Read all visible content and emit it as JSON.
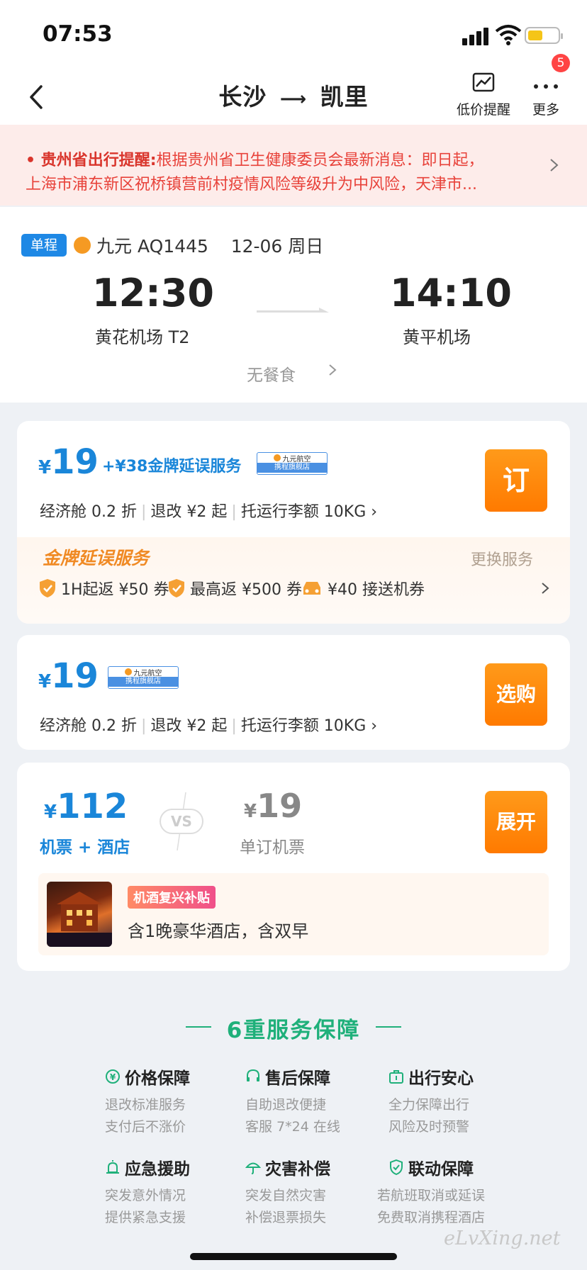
{
  "status_bar": {
    "time": "07:53",
    "battery_color": "#f5c518"
  },
  "nav": {
    "title": "长沙 ⟶ 凯里",
    "title_from": "长沙",
    "title_to": "凯里",
    "low_price_label": "低价提醒",
    "more_label": "更多",
    "more_badge": "5"
  },
  "notice": {
    "bold": "贵州省出行提醒:",
    "line1": "根据贵州省卫生健康委员会最新消息：即日起，",
    "line2": "上海市浦东新区祝桥镇营前村疫情风险等级升为中风险，天津市..."
  },
  "flight": {
    "trip_type": "单程",
    "info": "九元 AQ1445    12-06 周日",
    "dep_time": "12:30",
    "arr_time": "14:10",
    "dep_airport": "黄花机场 T2",
    "arr_airport": "黄平机场",
    "meal": "无餐食"
  },
  "cards": [
    {
      "price_symbol": "¥",
      "price": "19",
      "addon": "+¥38金牌延误服务",
      "tag_top": "九元航空",
      "tag_bottom": "携程旗舰店",
      "button": "订",
      "cabin": "经济舱 0.2 折",
      "refund": "退改 ¥2 起",
      "baggage": "托运行李额 10KG",
      "service_title": "金牌延误服务",
      "change_service": "更换服务",
      "perks": [
        "1H起返 ¥50 券",
        "最高返 ¥500 券",
        "¥40 接送机券"
      ]
    },
    {
      "price_symbol": "¥",
      "price": "19",
      "tag_top": "九元航空",
      "tag_bottom": "携程旗舰店",
      "button": "选购",
      "cabin": "经济舱 0.2 折",
      "refund": "退改 ¥2 起",
      "baggage": "托运行李额 10KG"
    },
    {
      "bundle_symbol": "¥",
      "bundle_price": "112",
      "bundle_label": "机票 + 酒店",
      "vs": "VS",
      "single_symbol": "¥",
      "single_price": "19",
      "single_label": "单订机票",
      "button": "展开",
      "hotel_tag": "机酒复兴补贴",
      "hotel_desc": "含1晚豪华酒店，含双早"
    }
  ],
  "services": {
    "title": "6重服务保障",
    "items": [
      {
        "title": "价格保障",
        "icon": "yen-circle-icon",
        "line1": "退改标准服务",
        "line2": "支付后不涨价"
      },
      {
        "title": "售后保障",
        "icon": "headset-icon",
        "line1": "自助退改便捷",
        "line2": "客服 7*24 在线"
      },
      {
        "title": "出行安心",
        "icon": "suitcase-icon",
        "line1": "全力保障出行",
        "line2": "风险及时预警"
      },
      {
        "title": "应急援助",
        "icon": "alarm-icon",
        "line1": "突发意外情况",
        "line2": "提供紧急支援"
      },
      {
        "title": "灾害补偿",
        "icon": "umbrella-icon",
        "line1": "突发自然灾害",
        "line2": "补偿退票损失"
      },
      {
        "title": "联动保障",
        "icon": "shield-check-icon",
        "line1": "若航班取消或延误",
        "line2": "免费取消携程酒店"
      }
    ]
  },
  "watermark": "eLvXing.net",
  "colors": {
    "accent_blue": "#1a86d9",
    "orange": "#ff8a00",
    "green": "#1fb07a",
    "notice_red": "#e8423a"
  }
}
